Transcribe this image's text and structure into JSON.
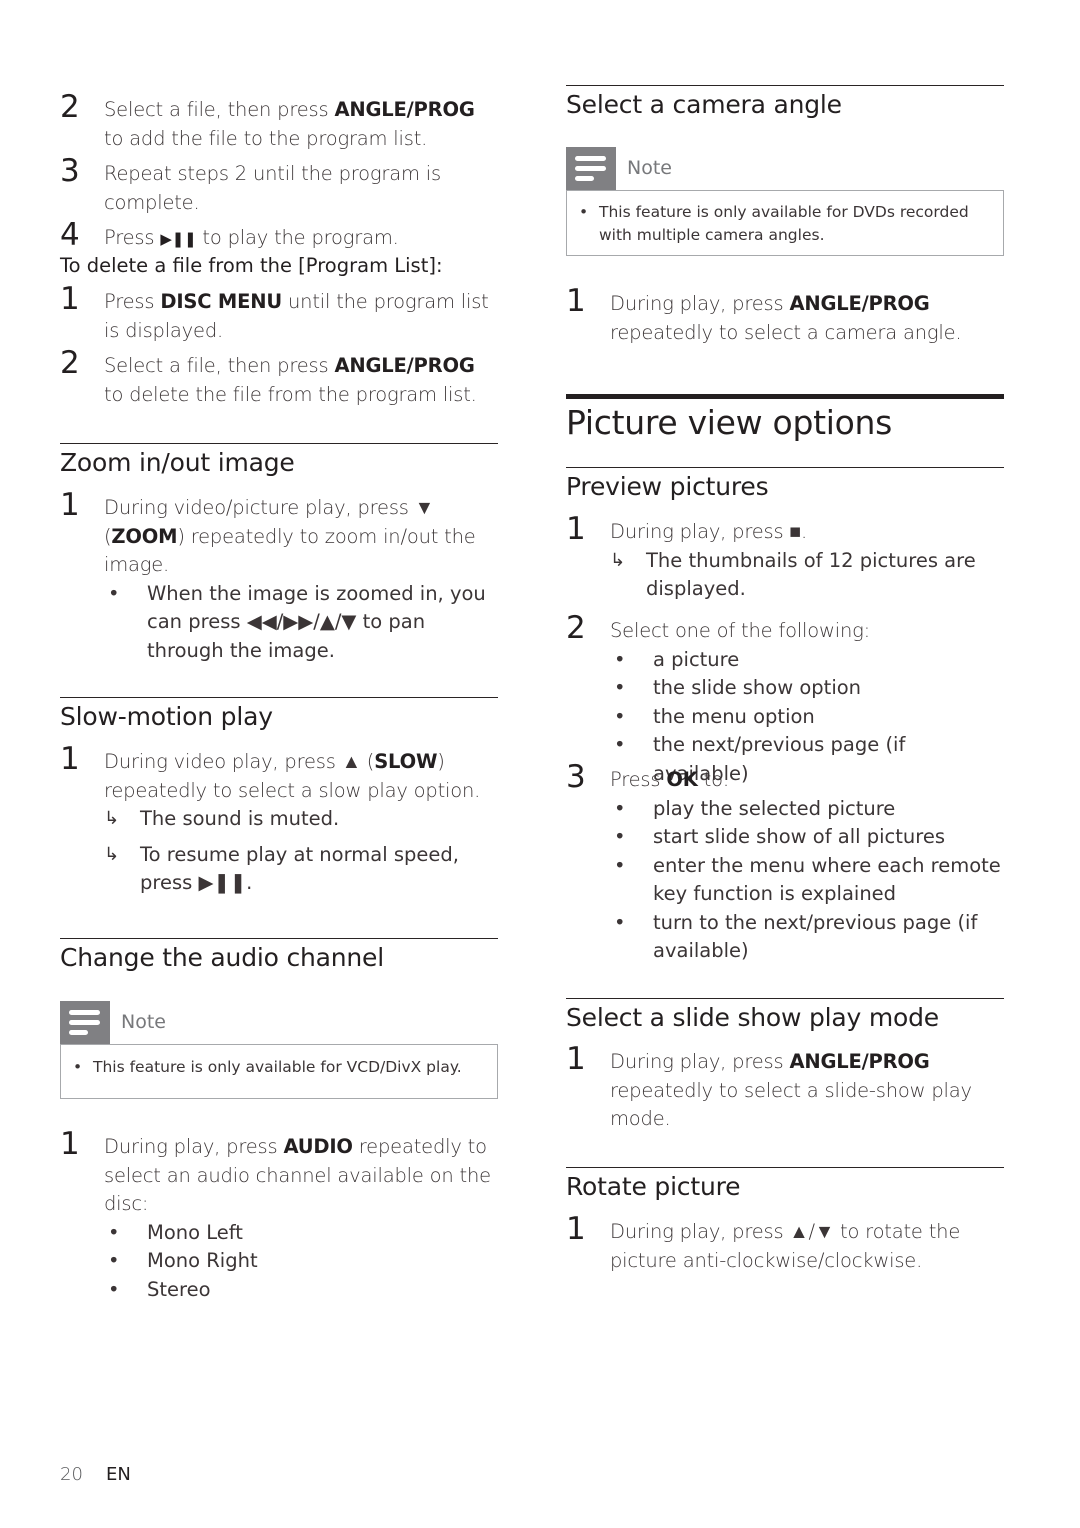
{
  "left": {
    "program_steps": [
      {
        "num": "2",
        "pre": "Select a file, then press ",
        "bold": "ANGLE/PROG",
        "post": " to add the file to the program list."
      },
      {
        "num": "3",
        "text": "Repeat steps 2 until the program is complete."
      },
      {
        "num": "4",
        "pre": "Press ",
        "icon": "▶❚❚",
        "post": " to play the program."
      }
    ],
    "delete_heading": "To delete a file from the [Program List]:",
    "delete_steps": [
      {
        "num": "1",
        "pre": "Press ",
        "bold": "DISC MENU",
        "post": " until the program list is displayed."
      },
      {
        "num": "2",
        "pre": "Select a file, then press ",
        "bold": "ANGLE/PROG",
        "post": " to delete the file from the program list."
      }
    ],
    "zoom": {
      "title": "Zoom in/out image",
      "num": "1",
      "pre": "During video/picture play, press ▼ (",
      "bold": "ZOOM",
      "post": ") repeatedly to zoom in/out the image.",
      "bullet": "When the image is zoomed in, you can press ◀◀/▶▶/▲/▼ to pan through the image."
    },
    "slow": {
      "title": "Slow-motion play",
      "num": "1",
      "pre": "During video play, press ▲ (",
      "bold": "SLOW",
      "post": ") repeatedly to select a slow play option.",
      "results": [
        "The sound is muted.",
        "To resume play at normal speed, press ▶❚❚."
      ]
    },
    "audio": {
      "title": "Change the audio channel",
      "note_label": "Note",
      "note_text": "This feature is only available for VCD/DivX play.",
      "num": "1",
      "pre": "During play, press ",
      "bold": "AUDIO",
      "post": " repeatedly to select an audio channel available on the disc:",
      "options": [
        "Mono Left",
        "Mono Right",
        "Stereo"
      ]
    }
  },
  "right": {
    "camera": {
      "title": "Select a camera angle",
      "note_label": "Note",
      "note_text": "This feature is only available for DVDs recorded with multiple camera angles.",
      "num": "1",
      "pre": "During play, press ",
      "bold": "ANGLE/PROG",
      "post": " repeatedly to select a camera angle."
    },
    "section_title": "Picture view options",
    "preview": {
      "title": "Preview pictures",
      "step1": {
        "num": "1",
        "text": "During play, press ■.",
        "result": "The thumbnails of 12 pictures are displayed."
      },
      "step2": {
        "num": "2",
        "text": "Select one of the following:",
        "options": [
          "a picture",
          "the slide show option",
          "the menu option",
          "the next/previous page (if available)"
        ]
      },
      "step3": {
        "num": "3",
        "pre": "Press ",
        "bold": "OK",
        "post": " to:",
        "options": [
          "play the selected picture",
          "start slide show of all pictures",
          "enter the menu where each remote key function is explained",
          "turn to the next/previous page (if available)"
        ]
      }
    },
    "slideshow": {
      "title": "Select a slide show play mode",
      "num": "1",
      "pre": "During play, press ",
      "bold": "ANGLE/PROG",
      "post": " repeatedly to select a slide-show play mode."
    },
    "rotate": {
      "title": "Rotate picture",
      "num": "1",
      "text": "During play, press ▲/▼ to rotate the picture anti-clockwise/clockwise."
    }
  },
  "footer": {
    "page_number": "20",
    "language": "EN"
  },
  "symbols": {
    "bullet": "•",
    "arrow": "↳"
  }
}
